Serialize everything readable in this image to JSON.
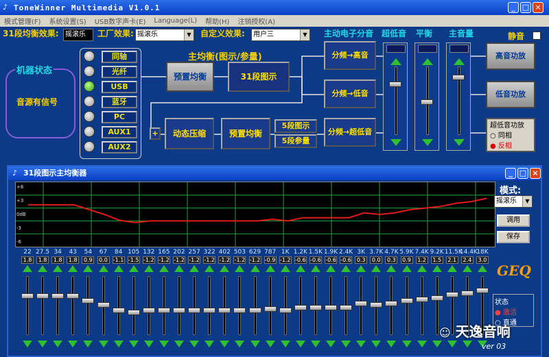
{
  "window": {
    "title": "ToneWinner Multimedia V1.0.1"
  },
  "menu": [
    "模式管理(F)",
    "系统设置(S)",
    "USB数字声卡(E)",
    "Language(L)",
    "帮助(H)",
    "注销授权(A)"
  ],
  "toolbar": {
    "eq31_label": "31段均衡效果:",
    "eq31_value": "摇滚乐",
    "factory_label": "工厂效果:",
    "factory_value": "摇滚乐",
    "custom_label": "自定义效果:",
    "custom_value": "用户三",
    "crossover_label": "主动电子分音",
    "subwoofer_label": "超低音",
    "balance_label": "平衡",
    "volume_label": "主音量",
    "mute_label": "静音"
  },
  "machine": {
    "title": "机器状态",
    "status": "音源有信号"
  },
  "sources": [
    "同轴",
    "光纤",
    "USB",
    "蓝牙",
    "PC",
    "AUX1",
    "AUX2"
  ],
  "active_source": "USB",
  "chain": {
    "main_eq_label": "主均衡(图示/参量)",
    "preset_eq": "预置均衡",
    "graphic_31": "31段图示",
    "dyn_comp": "动态压缩",
    "preset_eq2": "预置均衡",
    "graphic_5": "5段图示",
    "param_5": "5段参量",
    "xover_high": "分频→高音",
    "xover_low": "分频→低音",
    "xover_sub": "分频→超低音",
    "plus": "+"
  },
  "amps": {
    "high": "高音功放",
    "low": "低音功放",
    "sub": "超低音功放",
    "phase_in": "同相",
    "phase_out": "反相"
  },
  "eq_window": {
    "title": "31段图示主均衡器",
    "mode_label": "模式:",
    "mode_value": "摇滚乐",
    "apply_btn": "调用",
    "save_btn": "保存",
    "logo": "GEQ",
    "state_label": "状态",
    "state_active": "激活",
    "state_bypass": "直通",
    "version": "ver 03",
    "yaxis": [
      "+6",
      "+3",
      "0dB",
      "-3",
      "-6"
    ]
  },
  "watermark": "天逸音响",
  "bands": [
    {
      "f": "22",
      "g": "1.8"
    },
    {
      "f": "27.5",
      "g": "1.8"
    },
    {
      "f": "34",
      "g": "1.8"
    },
    {
      "f": "43",
      "g": "1.8"
    },
    {
      "f": "54",
      "g": "0.9"
    },
    {
      "f": "67",
      "g": "0.0"
    },
    {
      "f": "84",
      "g": "-1.1"
    },
    {
      "f": "105",
      "g": "-1.5"
    },
    {
      "f": "132",
      "g": "-1.2"
    },
    {
      "f": "165",
      "g": "-1.2"
    },
    {
      "f": "202",
      "g": "-1.2"
    },
    {
      "f": "257",
      "g": "-1.2"
    },
    {
      "f": "322",
      "g": "-1.2"
    },
    {
      "f": "402",
      "g": "-1.2"
    },
    {
      "f": "503",
      "g": "-1.2"
    },
    {
      "f": "629",
      "g": "-1.2"
    },
    {
      "f": "787",
      "g": "-0.9"
    },
    {
      "f": "1K",
      "g": "-1.2"
    },
    {
      "f": "1.2K",
      "g": "-0.6"
    },
    {
      "f": "1.5K",
      "g": "-0.6"
    },
    {
      "f": "1.9K",
      "g": "-0.6"
    },
    {
      "f": "2.4K",
      "g": "-0.6"
    },
    {
      "f": "3K",
      "g": "0.3"
    },
    {
      "f": "3.7K",
      "g": "0.0"
    },
    {
      "f": "4.7K",
      "g": "0.3"
    },
    {
      "f": "5.9K",
      "g": "0.9"
    },
    {
      "f": "7.4K",
      "g": "1.2"
    },
    {
      "f": "9.2K",
      "g": "1.5"
    },
    {
      "f": "11.5K",
      "g": "2.1"
    },
    {
      "f": "14.4K",
      "g": "2.4"
    },
    {
      "f": "18K",
      "g": "3.0"
    }
  ],
  "colors": {
    "accent": "#f4d000",
    "cyan": "#22d6e6",
    "curve": "#e11a1a",
    "grid": "#1aa83a"
  }
}
